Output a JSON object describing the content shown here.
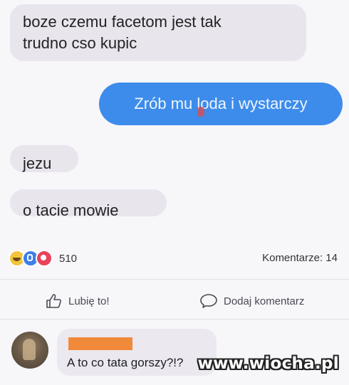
{
  "messages": [
    {
      "text": "boze czemu facetom jest tak\ntrudno cso kupic"
    },
    {
      "text": "Zrób mu loda i wystarczy"
    },
    {
      "text": "jezu"
    },
    {
      "text": "o tacie mowie"
    }
  ],
  "reactions": {
    "icons": [
      "haha-icon",
      "like-icon",
      "love-icon"
    ],
    "count": "510"
  },
  "comments_count": "Komentarze: 14",
  "actions": {
    "like_label": "Lubię to!",
    "comment_label": "Dodaj komentarz"
  },
  "comment": {
    "text": "A to co tata gorszy?!?"
  },
  "watermark": "www.wiocha.pl",
  "colors": {
    "outgoing_bubble": "#3d8ceb",
    "incoming_bubble": "#e9e5ed",
    "name_redaction": "#f08a3a"
  }
}
